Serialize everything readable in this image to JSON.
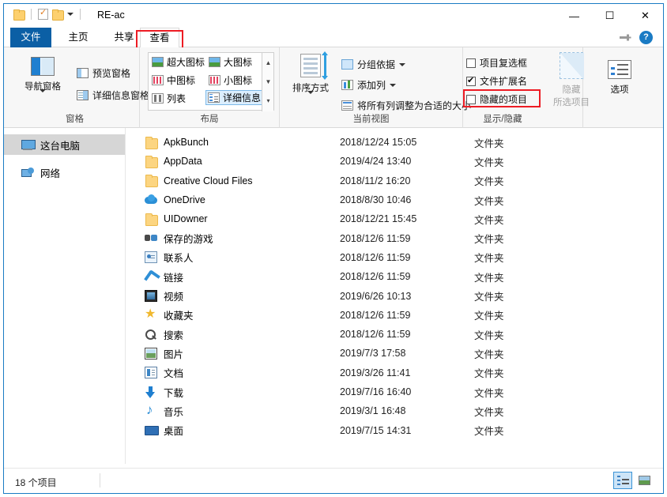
{
  "window": {
    "title": "RE-ac",
    "quick_access": [
      "folder-icon",
      "properties-icon",
      "new-folder-icon",
      "customize-chevron-icon"
    ],
    "minimize": "—",
    "maximize": "☐",
    "close": "✕",
    "help": "?"
  },
  "tabs": [
    {
      "label": "文件",
      "name": "tab-file"
    },
    {
      "label": "主页",
      "name": "tab-home"
    },
    {
      "label": "共享",
      "name": "tab-share"
    },
    {
      "label": "查看",
      "name": "tab-view",
      "active": true,
      "highlighted": true
    }
  ],
  "ribbon": {
    "groups": [
      {
        "label": "窗格",
        "big_button": "导航窗格",
        "commands": [
          "预览窗格",
          "详细信息窗格"
        ]
      },
      {
        "label": "布局",
        "gallery": [
          "超大图标",
          "大图标",
          "中图标",
          "小图标",
          "列表",
          "详细信息"
        ],
        "gallery_selected": "详细信息"
      },
      {
        "label": "当前视图",
        "big_button": "排序方式",
        "commands": [
          "分组依据",
          "添加列",
          "将所有列调整为合适的大小"
        ]
      },
      {
        "label": "显示/隐藏",
        "checkboxes": [
          {
            "label": "项目复选框",
            "checked": false
          },
          {
            "label": "文件扩展名",
            "checked": true
          },
          {
            "label": "隐藏的项目",
            "checked": false,
            "highlighted": true
          }
        ],
        "big_button_line1": "隐藏",
        "big_button_line2": "所选项目",
        "big_button_disabled": true
      },
      {
        "label": "",
        "big_button": "选项"
      }
    ]
  },
  "nav_pane": {
    "items": [
      {
        "label": "这台电脑",
        "icon": "this-pc-icon",
        "selected": true
      },
      {
        "label": "网络",
        "icon": "network-icon",
        "selected": false
      }
    ]
  },
  "file_list": {
    "rows": [
      {
        "name": "ApkBunch",
        "date": "2018/12/24 15:05",
        "type": "文件夹",
        "icon": "folder"
      },
      {
        "name": "AppData",
        "date": "2019/4/24 13:40",
        "type": "文件夹",
        "icon": "folder"
      },
      {
        "name": "Creative Cloud Files",
        "date": "2018/11/2 16:20",
        "type": "文件夹",
        "icon": "folder"
      },
      {
        "name": "OneDrive",
        "date": "2018/8/30 10:46",
        "type": "文件夹",
        "icon": "onedrive"
      },
      {
        "name": "UIDowner",
        "date": "2018/12/21 15:45",
        "type": "文件夹",
        "icon": "folder"
      },
      {
        "name": "保存的游戏",
        "date": "2018/12/6 11:59",
        "type": "文件夹",
        "icon": "games"
      },
      {
        "name": "联系人",
        "date": "2018/12/6 11:59",
        "type": "文件夹",
        "icon": "contacts"
      },
      {
        "name": "链接",
        "date": "2018/12/6 11:59",
        "type": "文件夹",
        "icon": "links"
      },
      {
        "name": "视频",
        "date": "2019/6/26 10:13",
        "type": "文件夹",
        "icon": "video"
      },
      {
        "name": "收藏夹",
        "date": "2018/12/6 11:59",
        "type": "文件夹",
        "icon": "star"
      },
      {
        "name": "搜索",
        "date": "2018/12/6 11:59",
        "type": "文件夹",
        "icon": "search"
      },
      {
        "name": "图片",
        "date": "2019/7/3 17:58",
        "type": "文件夹",
        "icon": "pictures"
      },
      {
        "name": "文档",
        "date": "2019/3/26 11:41",
        "type": "文件夹",
        "icon": "docs"
      },
      {
        "name": "下载",
        "date": "2019/7/16 16:40",
        "type": "文件夹",
        "icon": "down"
      },
      {
        "name": "音乐",
        "date": "2019/3/1 16:48",
        "type": "文件夹",
        "icon": "music"
      },
      {
        "name": "桌面",
        "date": "2019/7/15 14:31",
        "type": "文件夹",
        "icon": "desktop"
      }
    ]
  },
  "status_bar": {
    "item_count": "18 个项目",
    "view_details": "details-view-button",
    "view_large_icons": "large-icons-view-button"
  },
  "colors": {
    "accent": "#0b5fa5",
    "highlight_red": "#ed1c24",
    "selection": "#d6d6d6",
    "gallery_selection": "#dbeeff"
  }
}
